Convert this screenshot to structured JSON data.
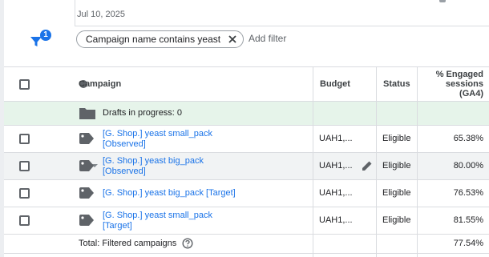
{
  "date_range": {
    "end_label": "Jul 10, 2025"
  },
  "filter_bar": {
    "active_count": "1",
    "chip_label": "Campaign name contains yeast",
    "add_filter_label": "Add filter"
  },
  "table": {
    "headers": {
      "campaign": "Campaign",
      "budget": "Budget",
      "status": "Status",
      "engaged_line1": "% Engaged",
      "engaged_line2": "sessions",
      "engaged_line3": "(GA4)"
    },
    "drafts": {
      "label": "Drafts in progress: 0"
    },
    "rows": [
      {
        "name_line1": "[G. Shop.] yeast small_pack",
        "name_line2": "[Observed]",
        "budget": "UAH1,...",
        "status": "Eligible",
        "engaged": "65.38%"
      },
      {
        "name_line1": "[G. Shop.] yeast big_pack",
        "name_line2": "[Observed]",
        "budget": "UAH1,...",
        "status": "Eligible",
        "engaged": "80.00%"
      },
      {
        "name_line1": "[G. Shop.] yeast big_pack [Target]",
        "name_line2": "",
        "budget": "UAH1,...",
        "status": "Eligible",
        "engaged": "76.53%"
      },
      {
        "name_line1": "[G. Shop.] yeast small_pack",
        "name_line2": "[Target]",
        "budget": "UAH1,...",
        "status": "Eligible",
        "engaged": "81.55%"
      }
    ],
    "total": {
      "label": "Total: Filtered campaigns",
      "engaged": "77.54%"
    }
  },
  "colors": {
    "accent": "#1a73e8",
    "eligible_dot": "#188038",
    "drafts_bg": "#e6f4ea",
    "hover_bg": "#f1f3f4"
  },
  "icons": [
    "filter-icon",
    "close-icon",
    "tag-icon",
    "folder-icon",
    "chevron-down-icon",
    "pencil-icon",
    "help-icon"
  ]
}
